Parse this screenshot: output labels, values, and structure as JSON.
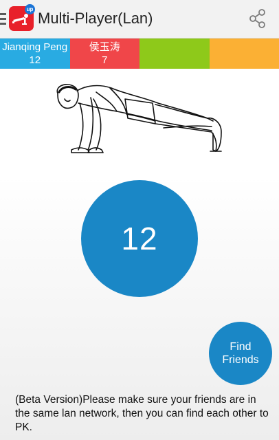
{
  "header": {
    "title": "Multi-Player(Lan)",
    "app_icon_badge": "up",
    "menu_icon": "hamburger-icon",
    "share_icon": "share-icon"
  },
  "players": [
    {
      "name": "Jianqing Peng",
      "count": "12",
      "color": "#29abe2"
    },
    {
      "name": "侯玉涛",
      "count": "7",
      "color": "#f04649"
    },
    {
      "name": "",
      "count": "",
      "color": "#8ec91a"
    },
    {
      "name": "",
      "count": "",
      "color": "#fbb034"
    }
  ],
  "main": {
    "illustration_icon": "pushup-figure-icon",
    "count": "12",
    "find_friends_label": "Find\nFriends"
  },
  "footer": {
    "note": "(Beta Version)Please make sure your friends are in the same lan network, then you can find each other to PK."
  }
}
